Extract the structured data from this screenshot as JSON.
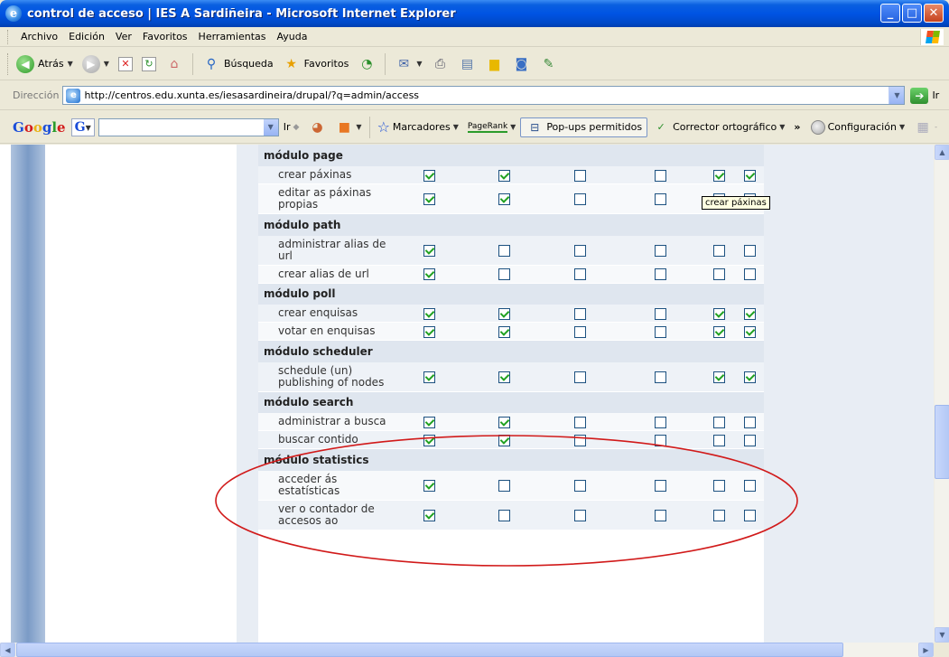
{
  "window": {
    "title": "control de acceso | IES A Sardiñeira - Microsoft Internet Explorer"
  },
  "menubar": [
    "Archivo",
    "Edición",
    "Ver",
    "Favoritos",
    "Herramientas",
    "Ayuda"
  ],
  "toolbar": {
    "back": "Atrás",
    "search": "Búsqueda",
    "favorites": "Favoritos"
  },
  "address": {
    "label": "Dirección",
    "url": "http://centros.edu.xunta.es/iesasardineira/drupal/?q=admin/access",
    "go": "Ir"
  },
  "google": {
    "logo": "Google",
    "go": "Ir",
    "bookmarks": "Marcadores",
    "pagerank": "PageRank",
    "popups": "Pop-ups permitidos",
    "spell": "Corrector ortográfico",
    "more": "»",
    "settings": "Configuración"
  },
  "tooltip": "crear páxinas",
  "permissions": [
    {
      "module": "módulo page",
      "rows": [
        {
          "name": "crear páxinas",
          "checks": [
            true,
            true,
            false,
            false,
            true,
            true
          ]
        },
        {
          "name": "editar as páxinas propias",
          "checks": [
            true,
            true,
            false,
            false,
            true,
            true
          ]
        }
      ]
    },
    {
      "module": "módulo path",
      "rows": [
        {
          "name": "administrar alias de url",
          "checks": [
            true,
            false,
            false,
            false,
            false,
            false
          ]
        },
        {
          "name": "crear alias de url",
          "checks": [
            true,
            false,
            false,
            false,
            false,
            false
          ]
        }
      ]
    },
    {
      "module": "módulo poll",
      "rows": [
        {
          "name": "crear enquisas",
          "checks": [
            true,
            true,
            false,
            false,
            true,
            true
          ]
        },
        {
          "name": "votar en enquisas",
          "checks": [
            true,
            true,
            false,
            false,
            true,
            true
          ]
        }
      ]
    },
    {
      "module": "módulo scheduler",
      "rows": [
        {
          "name": "schedule (un) publishing of nodes",
          "checks": [
            true,
            true,
            false,
            false,
            true,
            true
          ]
        }
      ]
    },
    {
      "module": "módulo search",
      "rows": [
        {
          "name": "administrar a busca",
          "checks": [
            true,
            true,
            false,
            false,
            false,
            false
          ]
        },
        {
          "name": "buscar contido",
          "checks": [
            true,
            true,
            false,
            false,
            false,
            false
          ]
        }
      ]
    },
    {
      "module": "módulo statistics",
      "rows": [
        {
          "name": "acceder ás estatísticas",
          "checks": [
            true,
            false,
            false,
            false,
            false,
            false
          ]
        },
        {
          "name": "ver o contador de accesos ao",
          "checks": [
            true,
            false,
            false,
            false,
            false,
            false
          ]
        }
      ]
    }
  ],
  "colors": {
    "annotation": "#D11A1A",
    "module_row": "#DFE6EF",
    "checkmark": "#21A121"
  }
}
